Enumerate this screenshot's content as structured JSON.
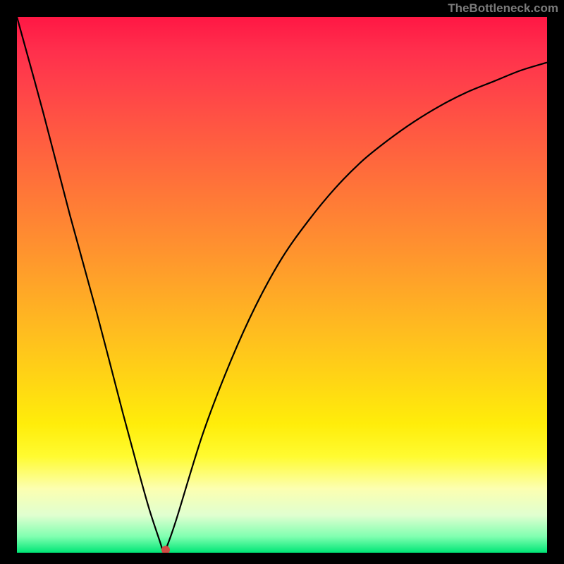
{
  "watermark": "TheBottleneck.com",
  "chart_data": {
    "type": "line",
    "title": "",
    "xlabel": "",
    "ylabel": "",
    "xlim": [
      0,
      100
    ],
    "ylim": [
      0,
      100
    ],
    "background": "vertical-gradient red-to-green",
    "series": [
      {
        "name": "bottleneck-curve",
        "x": [
          0,
          5,
          10,
          15,
          20,
          23,
          25,
          27,
          27.5,
          28,
          30,
          35,
          40,
          45,
          50,
          55,
          60,
          65,
          70,
          75,
          80,
          85,
          90,
          95,
          100
        ],
        "values": [
          100,
          82,
          63,
          45,
          26,
          15,
          8,
          2,
          0.5,
          0.5,
          6,
          22,
          35,
          46,
          55,
          62,
          68,
          73,
          77,
          80.5,
          83.5,
          86,
          88,
          90,
          91.5
        ]
      }
    ],
    "marker": {
      "name": "optimal-point",
      "x": 28,
      "y": 0.5,
      "color": "#d24a43"
    },
    "gradient_stops": [
      {
        "pos": 0,
        "color": "#ff1744"
      },
      {
        "pos": 50,
        "color": "#ffaa26"
      },
      {
        "pos": 80,
        "color": "#ffed0a"
      },
      {
        "pos": 100,
        "color": "#00e676"
      }
    ]
  }
}
